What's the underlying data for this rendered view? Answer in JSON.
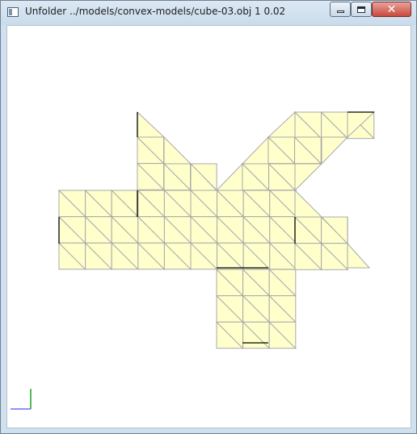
{
  "window": {
    "title": "Unfolder ../models/convex-models/cube-03.obj 1 0.02",
    "icon": "app-window-icon",
    "controls": {
      "minimize_icon": "minimize-icon",
      "maximize_icon": "maximize-icon",
      "close_glyph": "✕"
    }
  },
  "viewport": {
    "background": "#ffffff",
    "face_fill": "#ffffcc",
    "edge_color": "#a9a9a9",
    "cut_edge_color": "#000000",
    "axis_x_color": "#6b6bff",
    "axis_y_color": "#1aa31a"
  }
}
